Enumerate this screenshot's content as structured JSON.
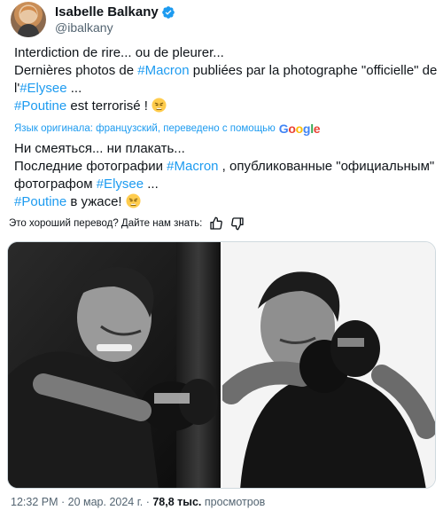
{
  "author": {
    "display_name": "Isabelle Balkany",
    "handle": "@ibalkany",
    "avatar_icon": "profile-photo",
    "verified_icon": "verified-badge-icon",
    "verified_color": "#1d9bf0"
  },
  "tweet": {
    "line1": "Interdiction de rire... ou de pleurer...",
    "line2_pre": "Dernières photos de ",
    "line2_tag": "#Macron",
    "line2_post": " publiées par la photographe \"officielle\" de",
    "line3_pre": "l'",
    "line3_tag": "#Elysee",
    "line3_post": " ...",
    "line4_tag": "#Poutine",
    "line4_post": " est terrorisé ! ",
    "emoji": "weary-face-emoji"
  },
  "translation_notice": {
    "text": "Язык оригинала: французский, переведено с помощью",
    "provider": "Google"
  },
  "translation": {
    "line1": "Ни смеяться... ни плакать...",
    "line2_pre": "Последние фотографии ",
    "line2_tag": "#Macron",
    "line2_post": " , опубликованные \"официальным\"",
    "line3_pre": "фотографом ",
    "line3_tag": "#Elysee",
    "line3_post": " ...",
    "line4_tag": "#Poutine",
    "line4_post": " в ужасе! "
  },
  "feedback": {
    "question": "Это хороший перевод? Дайте нам знать:",
    "thumbs_up_icon": "thumbs-up-icon",
    "thumbs_down_icon": "thumbs-down-icon"
  },
  "media": {
    "photo1": "boxing-photo-punching-bag",
    "photo2": "boxing-photo-guard-stance"
  },
  "meta": {
    "time": "12:32 PM",
    "sep1": " · ",
    "date": "20 мар. 2024 г.",
    "sep2": " · ",
    "views": "78,8 тыс.",
    "views_label": " просмотров"
  },
  "colors": {
    "link": "#1d9bf0",
    "text": "#0f1419",
    "muted": "#536471"
  }
}
